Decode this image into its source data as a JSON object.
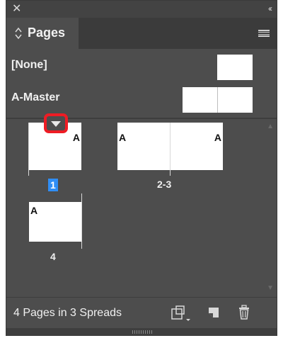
{
  "panel": {
    "close_glyph": "✕",
    "collapse_glyph": "‹‹",
    "tab_label": "Pages",
    "icons": {
      "close": "close-icon",
      "collapse": "collapse-icon",
      "tab_arrows": "updown-arrows-icon",
      "menu": "panel-menu-icon"
    }
  },
  "masters": [
    {
      "label": "[None]",
      "type": "single"
    },
    {
      "label": "A-Master",
      "type": "spread"
    }
  ],
  "pages": [
    {
      "number": "1",
      "letters": [
        "A"
      ],
      "selected": true
    },
    {
      "number": "2-3",
      "letters": [
        "A",
        "A"
      ],
      "selected": false
    },
    {
      "number": "4",
      "letters": [
        "A"
      ],
      "selected": false
    }
  ],
  "footer": {
    "status": "4 Pages in 3 Spreads",
    "icons": [
      "edit-page-size-icon",
      "new-page-icon",
      "trash-icon"
    ]
  },
  "colors": {
    "panel_bg": "#4d4d4d",
    "selection": "#2f8ef5",
    "highlight": "#ee1c24"
  }
}
